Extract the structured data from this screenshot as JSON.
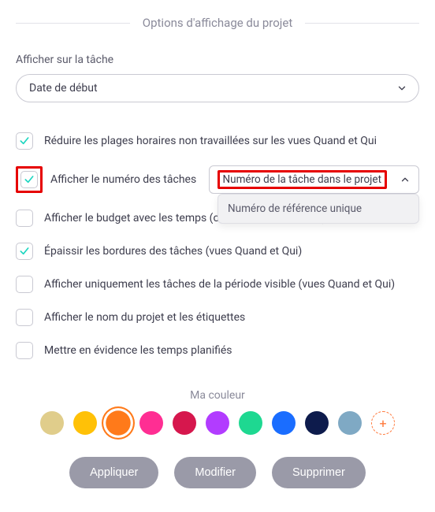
{
  "title": "Options d'affichage du projet",
  "display_on_task": {
    "label": "Afficher sur la tâche",
    "value": "Date de début"
  },
  "options": {
    "reduce_hours": {
      "label": "Réduire les plages horaires non travaillées sur les vues Quand et Qui",
      "checked": true
    },
    "show_task_num": {
      "label": "Afficher le numéro des tâches",
      "checked": true
    },
    "show_budget": {
      "label": "Afficher le budget avec les temps (onglet Qui d'une tâche)",
      "checked": false
    },
    "thicken": {
      "label": "Épaissir les bordures des tâches (vues Quand et Qui)",
      "checked": true
    },
    "visible_only": {
      "label": "Afficher uniquement les tâches de la période visible (vues Quand et Qui)",
      "checked": false
    },
    "show_name": {
      "label": "Afficher le nom du projet et les étiquettes",
      "checked": false
    },
    "highlight": {
      "label": "Mettre en évidence les temps planifiés",
      "checked": false
    }
  },
  "task_number_mode": {
    "selected": "Numéro de la tâche dans le projet",
    "other_option": "Numéro de référence unique"
  },
  "color_section": {
    "title": "Ma couleur",
    "swatches": [
      "#e0cd8b",
      "#ffc107",
      "#ff7a1a",
      "#ff2e93",
      "#d6174d",
      "#b23cff",
      "#1ed891",
      "#1a6dff",
      "#0d1b4c",
      "#7fa9c4"
    ],
    "selected_index": 2
  },
  "buttons": {
    "apply": "Appliquer",
    "modify": "Modifier",
    "delete": "Supprimer"
  }
}
